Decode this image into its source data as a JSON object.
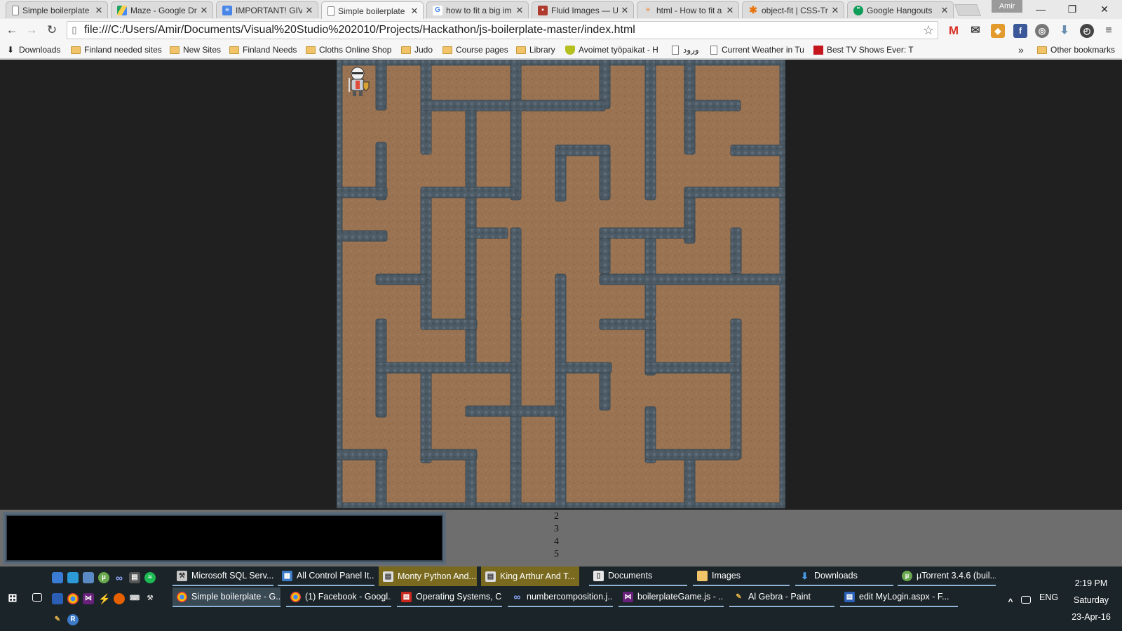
{
  "browser": {
    "tabs": [
      {
        "title": "Simple boilerplate",
        "icon": "page-icon"
      },
      {
        "title": "Maze - Google Drive",
        "icon": "drive-icon"
      },
      {
        "title": "IMPORTANT! GIVE",
        "icon": "docs-icon"
      },
      {
        "title": "Simple boilerplate",
        "icon": "page-icon",
        "active": true
      },
      {
        "title": "how to fit a big im",
        "icon": "google-icon"
      },
      {
        "title": "Fluid Images — Un",
        "icon": "fluid-icon"
      },
      {
        "title": "html - How to fit a",
        "icon": "stackoverflow-icon"
      },
      {
        "title": "object-fit | CSS-Tri",
        "icon": "csstricks-icon"
      },
      {
        "title": "Google Hangouts",
        "icon": "hangouts-icon"
      }
    ],
    "profile_name": "Amir",
    "window_controls": {
      "minimize": "—",
      "restore": "❐",
      "close": "✕"
    },
    "url": "file:///C:/Users/Amir/Documents/Visual%20Studio%202010/Projects/Hackathon/js-boilerplate-master/index.html",
    "bookmarks": [
      {
        "label": "Downloads",
        "icon": "download-icon"
      },
      {
        "label": "Finland needed sites",
        "icon": "folder-icon"
      },
      {
        "label": "New Sites",
        "icon": "folder-icon"
      },
      {
        "label": "Finland Needs",
        "icon": "folder-icon"
      },
      {
        "label": "Cloths Online Shop",
        "icon": "folder-icon"
      },
      {
        "label": "Judo",
        "icon": "folder-icon"
      },
      {
        "label": "Course pages",
        "icon": "folder-icon"
      },
      {
        "label": "Library",
        "icon": "folder-icon"
      },
      {
        "label": "Avoimet työpaikat - H",
        "icon": "shield-icon"
      },
      {
        "label": "ورود",
        "icon": "page-icon"
      },
      {
        "label": "Current Weather in Tu",
        "icon": "page-icon"
      },
      {
        "label": "Best TV Shows Ever: T",
        "icon": "tvshows-icon"
      }
    ],
    "bookmarks_overflow": "»",
    "other_bookmarks": "Other bookmarks"
  },
  "game": {
    "colors": {
      "floor": "#9a7352",
      "wall": "#4d5b66",
      "frame": "#55636e"
    },
    "line_numbers": [
      "2",
      "3",
      "4",
      "5"
    ]
  },
  "taskbar": {
    "top_row": [
      {
        "label": "Microsoft SQL Serv...",
        "icon": "sqlserver-icon"
      },
      {
        "label": "All Control Panel It...",
        "icon": "controlpanel-icon"
      },
      {
        "label": "Monty Python And...",
        "icon": "video-icon"
      },
      {
        "label": "King Arthur And T...",
        "icon": "video-icon"
      },
      {
        "label": "Documents",
        "icon": "documents-icon"
      },
      {
        "label": "Images",
        "icon": "folder-icon"
      },
      {
        "label": "Downloads",
        "icon": "download-icon"
      },
      {
        "label": "µTorrent 3.4.6  (buil...",
        "icon": "utorrent-icon"
      }
    ],
    "bottom_row": [
      {
        "label": "Simple boilerplate - G...",
        "icon": "chrome-icon"
      },
      {
        "label": "(1) Facebook - Googl...",
        "icon": "chrome-icon"
      },
      {
        "label": "Operating Systems, C...",
        "icon": "pdf-icon"
      },
      {
        "label": "numbercomposition.j...",
        "icon": "link-icon"
      },
      {
        "label": "boilerplateGame.js - ...",
        "icon": "visualstudio-icon"
      },
      {
        "label": "Al Gebra - Paint",
        "icon": "paint-icon"
      },
      {
        "label": "edit MyLogin.aspx - F...",
        "icon": "editor-icon"
      }
    ],
    "tray": {
      "language": "ENG",
      "time": "2:19 PM",
      "day": "Saturday",
      "date": "23-Apr-16"
    }
  }
}
